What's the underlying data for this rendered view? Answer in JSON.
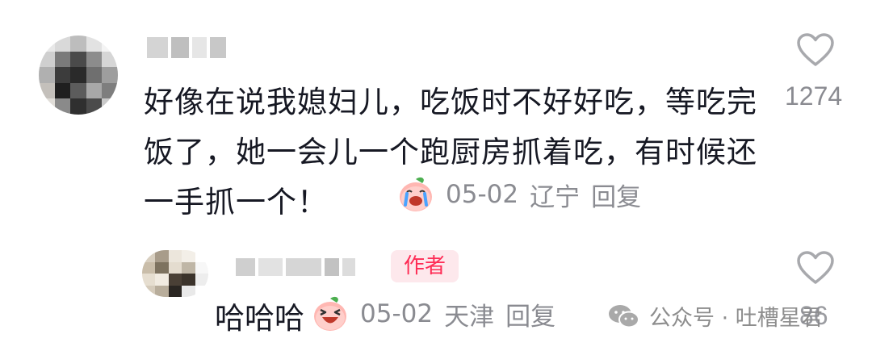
{
  "comment": {
    "username": "",
    "text": "好像在说我媳妇儿，吃饭时不好好吃，等吃完饭了，她一会儿一个跑厨房抓着吃，有时候还一手抓一个！",
    "emoji": "crying-laughing-peach-emoji",
    "date": "05-02",
    "location": "辽宁",
    "reply_label": "回复",
    "like_count": "1274",
    "like_icon": "heart-outline-icon"
  },
  "reply": {
    "username": "",
    "author_tag": "作者",
    "text": "哈哈哈",
    "emoji": "laughing-peach-emoji",
    "date": "05-02",
    "location": "天津",
    "reply_label": "回复",
    "like_count": "86",
    "like_icon": "heart-outline-icon"
  },
  "watermark": {
    "icon": "wechat-icon",
    "text": "公众号 · 吐槽星君"
  },
  "colors": {
    "primary_text": "#161823",
    "secondary_text": "#8a8b91",
    "author_tag_bg": "#fde8ec",
    "author_tag_text": "#fe2c55"
  }
}
